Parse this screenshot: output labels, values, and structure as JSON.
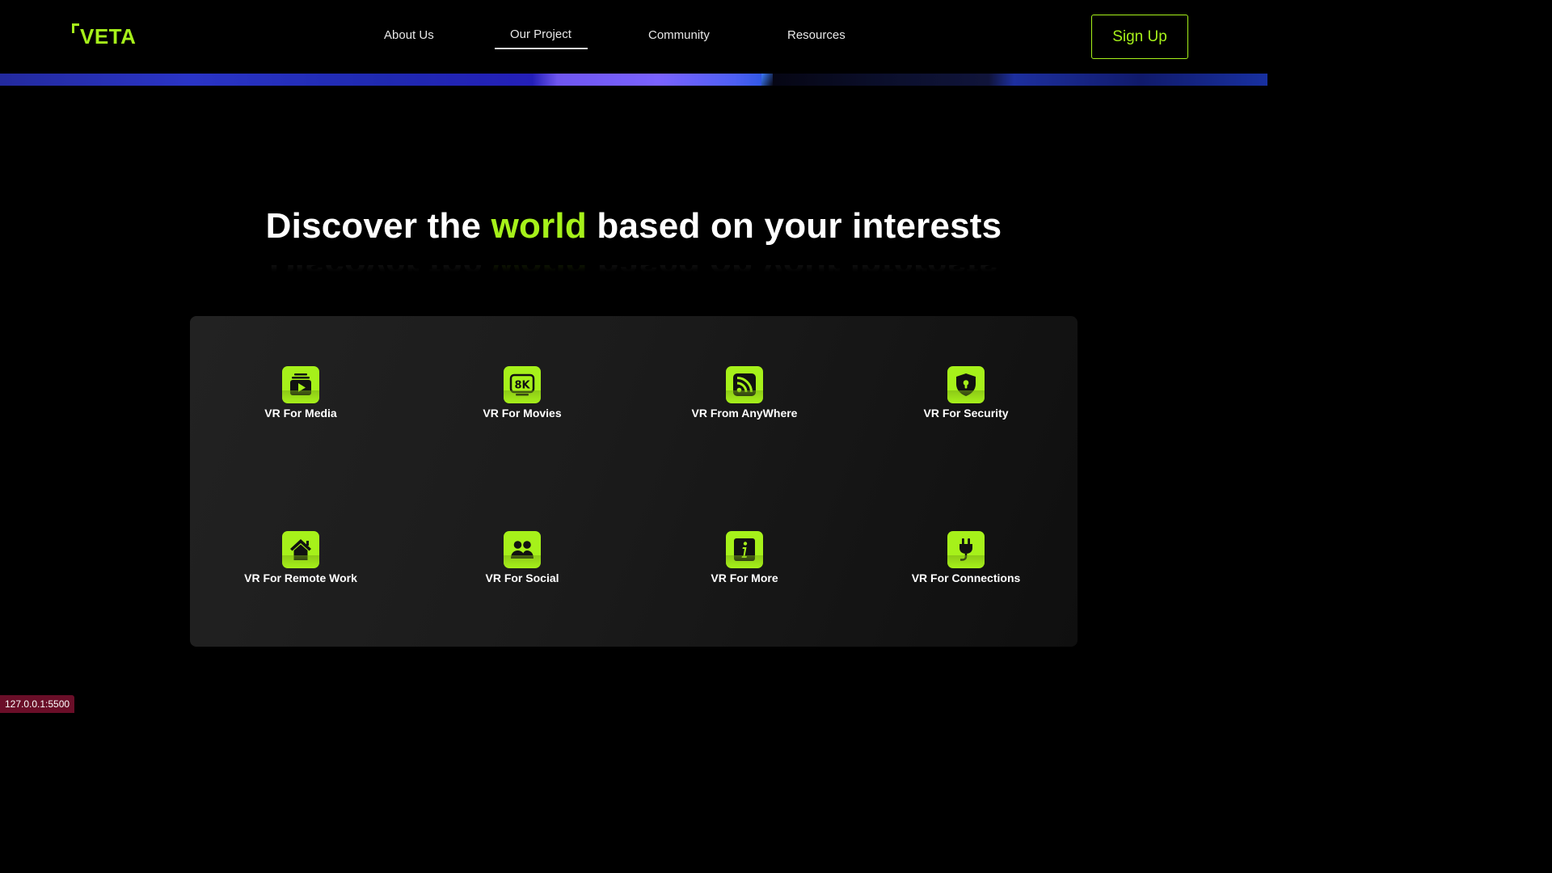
{
  "header": {
    "logo_text": "VETA",
    "nav": [
      {
        "label": "About Us"
      },
      {
        "label": "Our Project"
      },
      {
        "label": "Community"
      },
      {
        "label": "Resources"
      }
    ],
    "signup_label": "Sign Up"
  },
  "hero": {
    "heading_before": "Discover the ",
    "heading_accent": "world",
    "heading_after": " based on your interests"
  },
  "features": [
    {
      "label": "VR For Media",
      "icon": "play-media-icon"
    },
    {
      "label": "VR For Movies",
      "icon": "8k-icon"
    },
    {
      "label": "VR From AnyWhere",
      "icon": "rss-feed-icon"
    },
    {
      "label": "VR For Security",
      "icon": "shield-lock-icon"
    },
    {
      "label": "VR For Remote Work",
      "icon": "home-icon"
    },
    {
      "label": "VR For Social",
      "icon": "users-icon"
    },
    {
      "label": "VR For More",
      "icon": "info-icon"
    },
    {
      "label": "VR For Connections",
      "icon": "plug-icon"
    }
  ],
  "status_bar": {
    "url": "127.0.0.1:5500"
  },
  "colors": {
    "accent": "#a6f11a",
    "background": "#000000",
    "panel": "#1b1b1b",
    "status": "#6a0e28"
  }
}
